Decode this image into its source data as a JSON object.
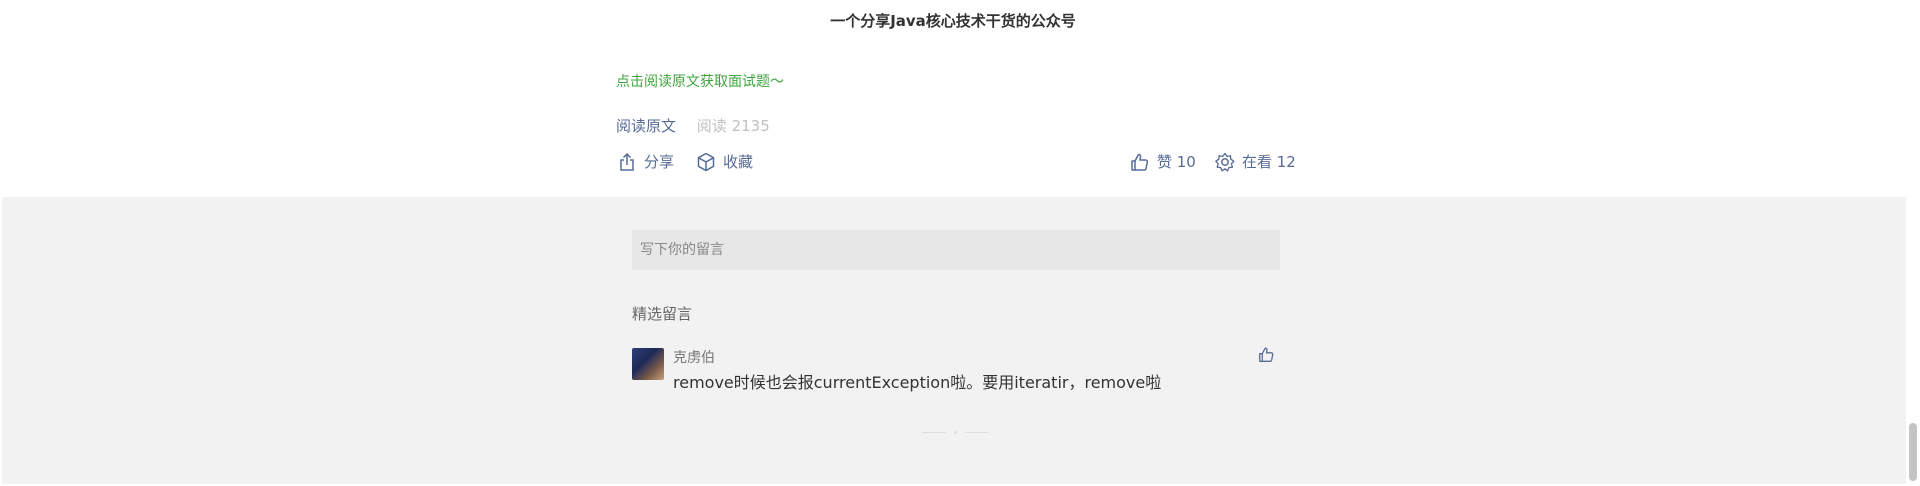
{
  "article": {
    "tagline": "一个分享Java核心技术干货的公众号",
    "note": "点击阅读原文获取面试题～",
    "read_original": "阅读原文",
    "read_count": "阅读 2135"
  },
  "actions": {
    "share": "分享",
    "favorite": "收藏",
    "like": "赞 10",
    "see": "在看 12"
  },
  "comments": {
    "input_placeholder": "写下你的留言",
    "section_title": "精选留言",
    "items": [
      {
        "nickname": "克虏伯",
        "text": "remove时候也会报currentException啦。要用iteratir，remove啦"
      }
    ]
  },
  "colors": {
    "link": "#576b95",
    "green": "#3fa43f",
    "comment_bg": "#f2f2f2"
  }
}
